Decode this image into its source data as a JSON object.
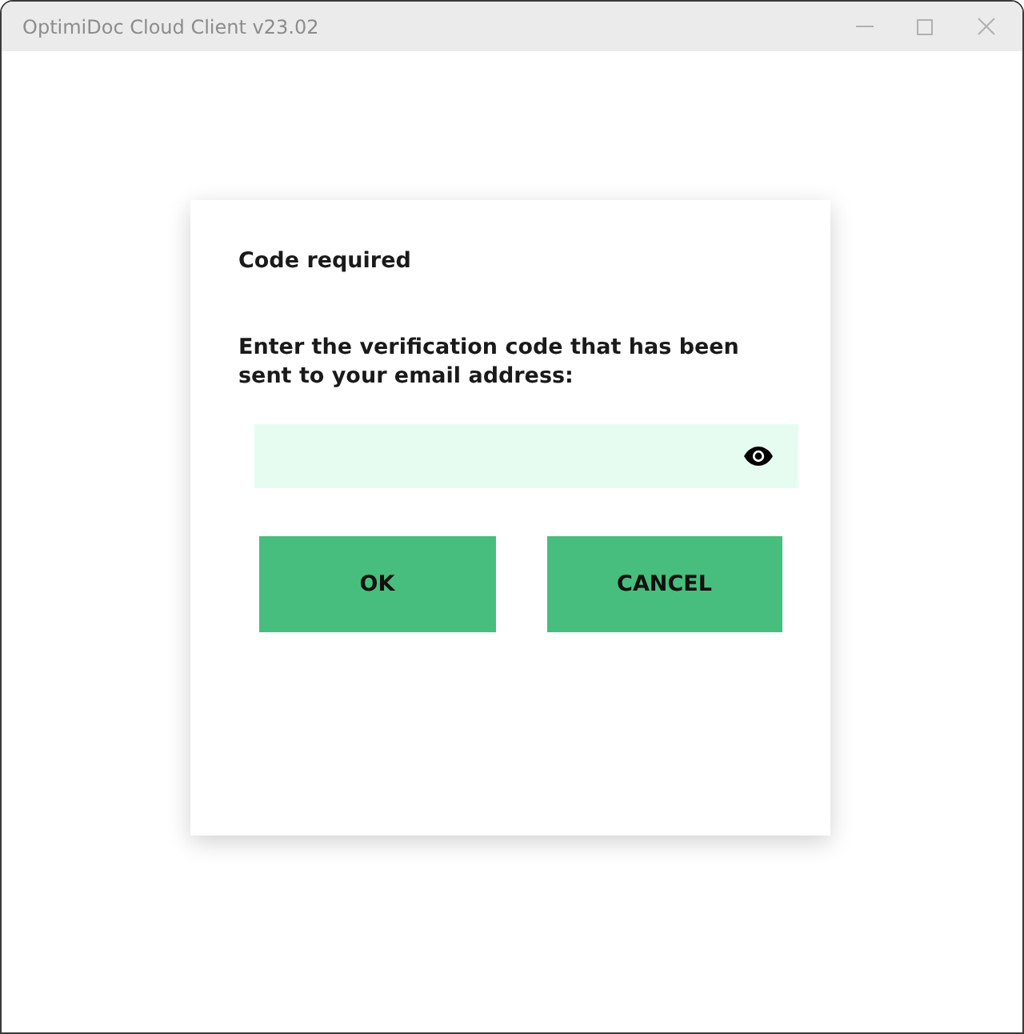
{
  "window": {
    "title": "OptimiDoc Cloud Client v23.02"
  },
  "dialog": {
    "title": "Code required",
    "message": "Enter the verification code that has been sent to your email address:",
    "code_field": {
      "masked": true
    },
    "buttons": [
      {
        "label": "OK"
      },
      {
        "label": "CANCEL"
      }
    ]
  }
}
